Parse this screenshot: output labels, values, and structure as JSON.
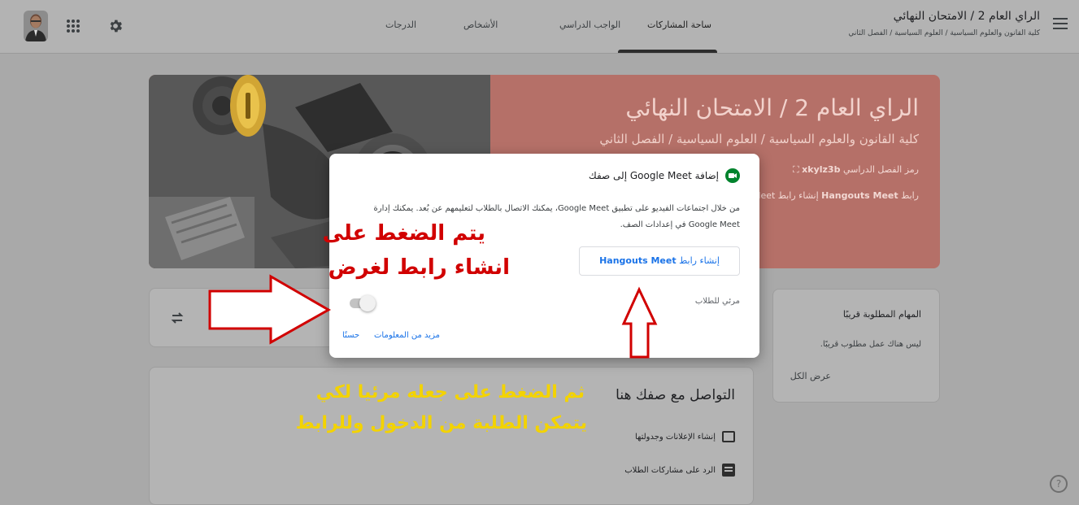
{
  "header": {
    "course_title": "الراي العام 2 / الامتحان النهائي",
    "course_subtitle": "كلية القانون والعلوم السياسية / العلوم السياسية / الفصل الثاني",
    "tabs": [
      {
        "label": "ساحة المشاركات",
        "active": true
      },
      {
        "label": "الواجب الدراسي",
        "active": false
      },
      {
        "label": "الأشخاص",
        "active": false
      },
      {
        "label": "الدرجات",
        "active": false
      }
    ],
    "icons": {
      "menu": "hamburger-icon",
      "settings": "gear-icon",
      "apps": "apps-grid-icon",
      "account": "avatar"
    }
  },
  "banner": {
    "title": "الراي العام 2 / الامتحان النهائي",
    "subtitle": "كلية القانون والعلوم السياسية / العلوم السياسية / الفصل الثاني",
    "code_label": "رمز الفصل الدراسي",
    "code_value": "xkylz3b",
    "meet_label": "رابط",
    "meet_value": "Hangouts Meet",
    "meet_action": "إنشاء رابط Meet"
  },
  "upcoming": {
    "title": "المهام المطلوبة قريبًا",
    "empty_text": "ليس هناك عمل مطلوب قريبًا.",
    "view_all": "عرض الكل"
  },
  "connect": {
    "title": "التواصل مع صفك هنا",
    "items": [
      {
        "label": "إنشاء الإعلانات وجدولتها",
        "icon": "announcement-icon"
      },
      {
        "label": "الرد على مشاركات الطلاب",
        "icon": "reply-list-icon"
      }
    ]
  },
  "dialog": {
    "title": "إضافة Google Meet إلى صفك",
    "body": "من خلال اجتماعات الفيديو على تطبيق Google Meet، يمكنك الاتصال بالطلاب لتعليمهم عن بُعد. يمكنك إدارة Google Meet في إعدادات الصف.",
    "create_prefix": "إنشاء رابط",
    "create_name": "Hangouts Meet",
    "visible_label": "مرئي للطلاب",
    "toggle_on": false,
    "learn_more": "مزيد من المعلومات",
    "ok": "حسنًا"
  },
  "annotations": {
    "red_line1": "يتم الضغط على",
    "red_line2": "انشاء رابط لغرض",
    "yellow_line1": "ثم الضغط على جعله مرئيا لكي",
    "yellow_line2": "يتمكن الطلبة من الدخول وللرابط"
  },
  "colors": {
    "banner": "#b57068",
    "link": "#1a73e8",
    "annotation_red": "#d10000",
    "annotation_yellow": "#f3d300"
  }
}
